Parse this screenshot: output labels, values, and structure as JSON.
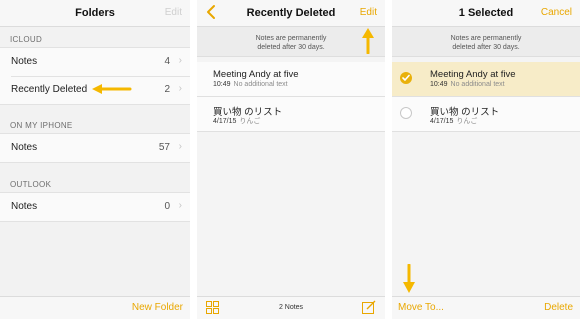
{
  "folders_panel": {
    "title": "Folders",
    "edit_label": "Edit",
    "sections": [
      {
        "header": "ICLOUD",
        "items": [
          {
            "label": "Notes",
            "count": "4"
          },
          {
            "label": "Recently Deleted",
            "count": "2"
          }
        ]
      },
      {
        "header": "ON MY IPHONE",
        "items": [
          {
            "label": "Notes",
            "count": "57"
          }
        ]
      },
      {
        "header": "OUTLOOK",
        "items": [
          {
            "label": "Notes",
            "count": "0"
          }
        ]
      }
    ],
    "new_folder_label": "New Folder"
  },
  "deleted_panel": {
    "title": "Recently Deleted",
    "edit_label": "Edit",
    "banner_line1": "Notes are permanently",
    "banner_line2": "deleted after 30 days.",
    "notes": [
      {
        "title": "Meeting Andy at five",
        "time": "10:49",
        "preview": "No additional text"
      },
      {
        "title": "買い物 のリスト",
        "time": "4/17/15",
        "preview": "りんご"
      }
    ],
    "notes_count_label": "2 Notes"
  },
  "select_panel": {
    "title": "1 Selected",
    "cancel_label": "Cancel",
    "banner_line1": "Notes are permanently",
    "banner_line2": "deleted after 30 days.",
    "notes": [
      {
        "title": "Meeting Andy at five",
        "time": "10:49",
        "preview": "No additional text",
        "selected": true
      },
      {
        "title": "買い物 のリスト",
        "time": "4/17/15",
        "preview": "りんご",
        "selected": false
      }
    ],
    "move_to_label": "Move To...",
    "delete_label": "Delete"
  },
  "colors": {
    "accent": "#e9a700",
    "selected_row": "#f7ecc8",
    "arrow": "#f5b800"
  },
  "icons": [
    "chevron-left-icon",
    "chevron-right-icon",
    "grid-icon",
    "compose-icon",
    "checkmark-icon",
    "arrow-icon"
  ]
}
